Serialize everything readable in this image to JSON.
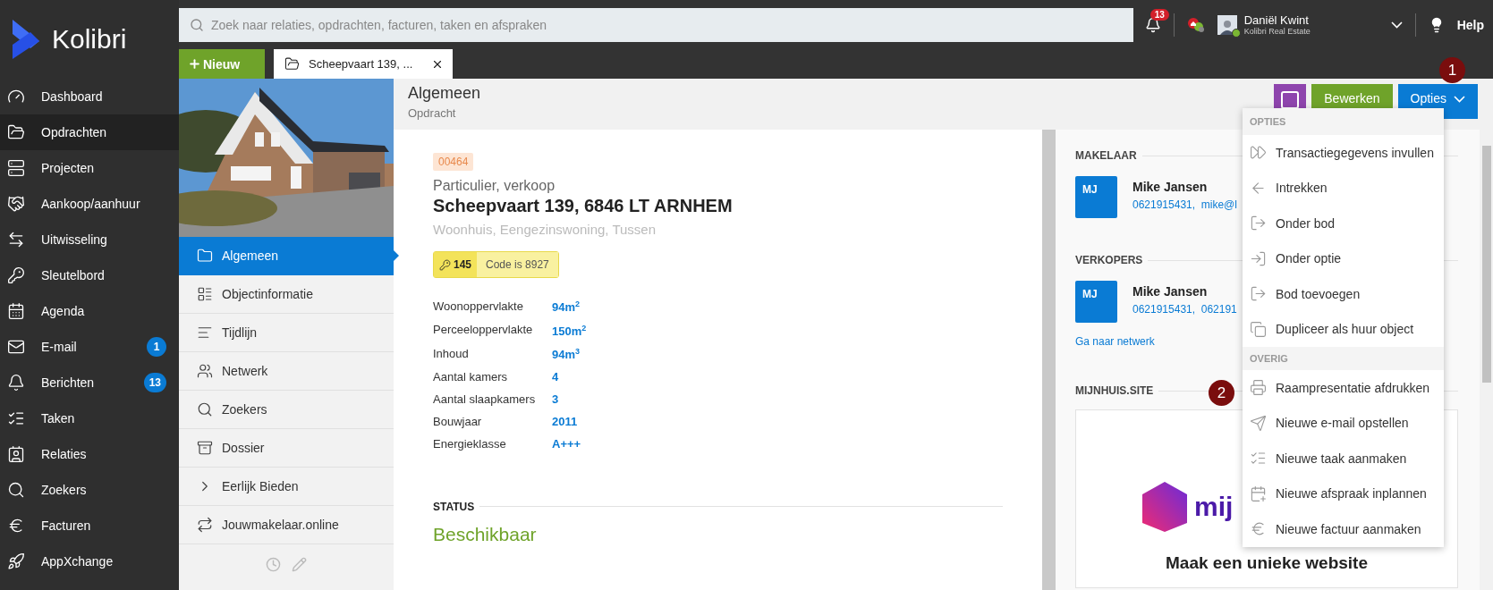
{
  "app": {
    "logo": "Kolibri"
  },
  "sidebar": {
    "items": [
      {
        "label": "Dashboard",
        "selected": false
      },
      {
        "label": "Opdrachten",
        "selected": true
      },
      {
        "label": "Projecten",
        "selected": false
      },
      {
        "label": "Aankoop/aanhuur",
        "selected": false
      },
      {
        "label": "Uitwisseling",
        "selected": false
      },
      {
        "label": "Sleutelbord",
        "selected": false
      },
      {
        "label": "Agenda",
        "selected": false
      },
      {
        "label": "E-mail",
        "selected": false,
        "badge": "1"
      },
      {
        "label": "Berichten",
        "selected": false,
        "badge": "13"
      },
      {
        "label": "Taken",
        "selected": false
      },
      {
        "label": "Relaties",
        "selected": false
      },
      {
        "label": "Zoekers",
        "selected": false
      },
      {
        "label": "Facturen",
        "selected": false
      },
      {
        "label": "AppXchange",
        "selected": false
      }
    ]
  },
  "search": {
    "placeholder": "Zoek naar relaties, opdrachten, facturen, taken en afspraken"
  },
  "topbar": {
    "notifications": "13",
    "user": {
      "name": "Daniël Kwint",
      "company": "Kolibri Real Estate",
      "online": true
    },
    "help": "Help"
  },
  "tabs": {
    "new_button": "Nieuw",
    "items": [
      {
        "label": "Scheepvaart 139, ...",
        "selected": true
      }
    ]
  },
  "page_header": {
    "title": "Algemeen",
    "subtitle": "Opdracht",
    "buttons": [
      {
        "kind": "icon",
        "color": "#8e44ad"
      },
      {
        "kind": "text",
        "label": "Bewerken",
        "color": "#6fa32a"
      },
      {
        "kind": "dropdown",
        "label": "Opties",
        "color": "#0a7bd4"
      }
    ]
  },
  "object_nav": {
    "items": [
      {
        "label": "Algemeen",
        "selected": true
      },
      {
        "label": "Objectinformatie",
        "selected": false
      },
      {
        "label": "Tijdlijn",
        "selected": false
      },
      {
        "label": "Netwerk",
        "selected": false
      },
      {
        "label": "Zoekers",
        "selected": false
      },
      {
        "label": "Dossier",
        "selected": false
      },
      {
        "label": "Eerlijk Bieden",
        "selected": false
      },
      {
        "label": "Jouwmakelaar.online",
        "selected": false
      }
    ]
  },
  "details": {
    "number": "00464",
    "category": "Particulier, verkoop",
    "address": "Scheepvaart 139, 6846 LT ARNHEM",
    "type": "Woonhuis, Eengezinswoning, Tussen",
    "key": {
      "number": "145",
      "code": "Code is 8927"
    },
    "facts": [
      {
        "label": "Woonoppervlakte",
        "value": "94m$^{2}$"
      },
      {
        "label": "Perceeloppervlakte",
        "value": "150m$^{2}$"
      },
      {
        "label": "Inhoud",
        "value": "94m$^{3}$"
      },
      {
        "label": "Aantal kamers",
        "value": "4"
      },
      {
        "label": "Aantal slaapkamers",
        "value": "3"
      },
      {
        "label": "Bouwjaar",
        "value": "2011"
      },
      {
        "label": "Energieklasse",
        "value": "A+++"
      }
    ],
    "status": {
      "heading": "STATUS",
      "value": "Beschikbaar"
    }
  },
  "contacts": {
    "sections": [
      {
        "heading": "MAKELAAR",
        "people": [
          {
            "initials": "MJ",
            "name": "Mike Jansen",
            "details": "0621915431,  mike@l"
          }
        ]
      },
      {
        "heading": "VERKOPERS",
        "people": [
          {
            "initials": "MJ",
            "name": "Mike Jansen",
            "details": "0621915431,  062191"
          }
        ],
        "link": "Ga naar netwerk"
      }
    ],
    "promo": {
      "heading": "MIJNHUIS.SITE",
      "logo_text": "mij",
      "title": "Maak een unieke website"
    }
  },
  "menu": {
    "groups": [
      {
        "heading": "OPTIES",
        "items": [
          "Transactiegegevens invullen",
          "Intrekken",
          "Onder bod",
          "Onder optie",
          "Bod toevoegen",
          "Dupliceer als huur object"
        ]
      },
      {
        "heading": "OVERIG",
        "items": [
          "Raampresentatie afdrukken",
          "Nieuwe e-mail opstellen",
          "Nieuwe taak aanmaken",
          "Nieuwe afspraak inplannen",
          "Nieuwe factuur aanmaken"
        ]
      }
    ]
  },
  "callouts": [
    "1",
    "2"
  ]
}
